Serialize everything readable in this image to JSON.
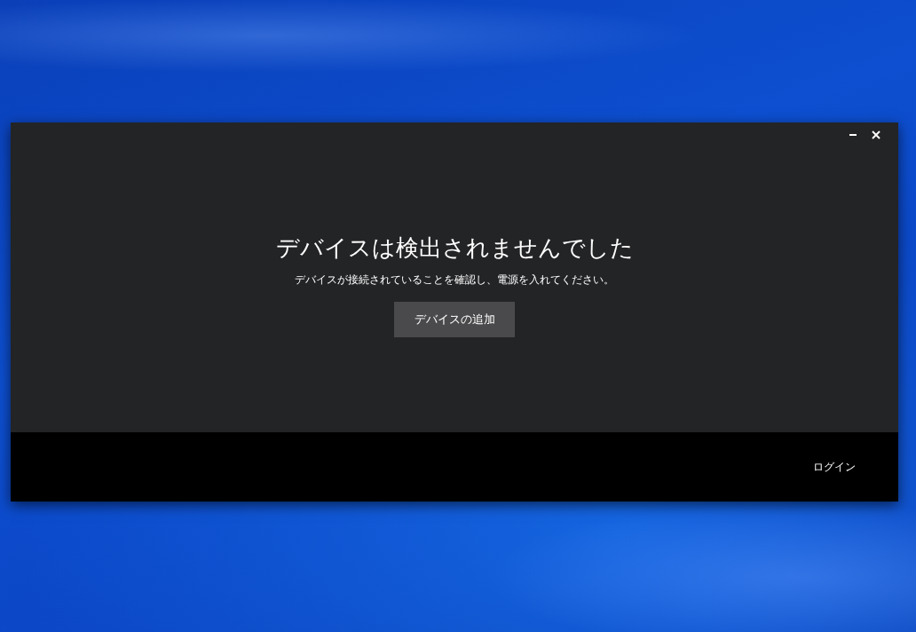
{
  "dialog": {
    "heading": "デバイスは検出されませんでした",
    "message": "デバイスが接続されていることを確認し、電源を入れてください。",
    "add_button": "デバイスの追加"
  },
  "footer": {
    "login_link": "ログイン"
  }
}
